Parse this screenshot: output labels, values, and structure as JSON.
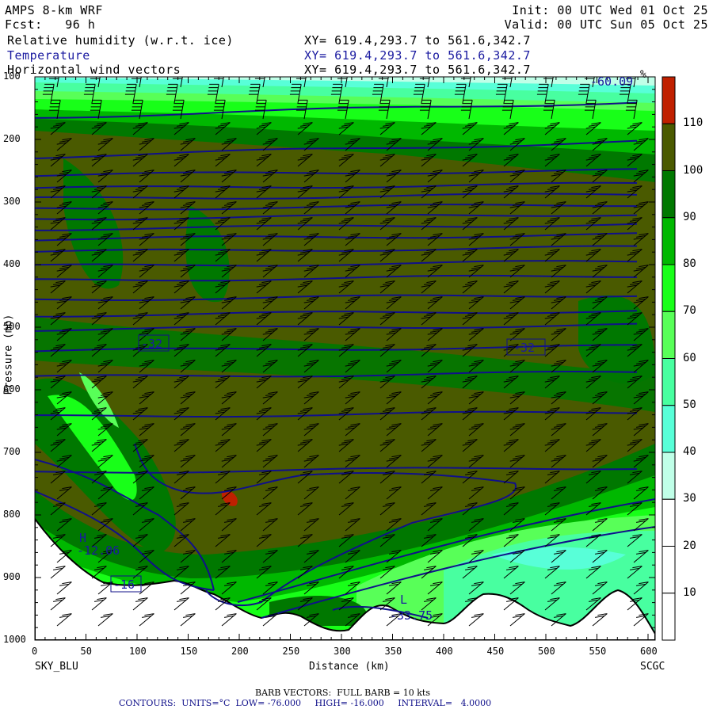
{
  "header": {
    "model": "AMPS 8-km WRF",
    "forecast": "Fcst:   96 h",
    "init": "Init: 00 UTC Wed 01 Oct 25",
    "valid": "Valid: 00 UTC Sun 05 Oct 25",
    "fields": [
      {
        "name": "Relative humidity (w.r.t. ice)",
        "xy": "XY= 619.4,293.7 to 561.6,342.7"
      },
      {
        "name": "Temperature",
        "xy": "XY= 619.4,293.7 to 561.6,342.7"
      },
      {
        "name": "Horizontal wind vectors",
        "xy": "XY= 619.4,293.7 to 561.6,342.7"
      }
    ]
  },
  "colors": {
    "contour": "#10108a",
    "label_blue": "#1a1aa0"
  },
  "chart_data": {
    "type": "heatmap",
    "title": "Cross-section: RH (w.r.t. ice), Temperature, Horizontal wind",
    "xlabel": "Distance (km)",
    "ylabel": "Pressure (mb)",
    "xlim": [
      0,
      610
    ],
    "ylim": [
      1000,
      100
    ],
    "x_ticks": [
      "0",
      "50",
      "100",
      "150",
      "200",
      "250",
      "300",
      "350",
      "400",
      "450",
      "500",
      "550",
      "600"
    ],
    "y_ticks": [
      "100",
      "200",
      "300",
      "400",
      "500",
      "600",
      "700",
      "800",
      "900",
      "1000"
    ],
    "x_endpoints": {
      "left": "SKY_BLU",
      "right": "SCGC"
    },
    "colorbar": {
      "unit": "%",
      "labels": [
        "110",
        "100",
        "90",
        "80",
        "70",
        "60",
        "50",
        "40",
        "30",
        "20",
        "10"
      ],
      "bins": [
        {
          "range": ">110",
          "color": "#c02000"
        },
        {
          "range": "100-110",
          "color": "#4a5a00"
        },
        {
          "range": "90-100",
          "color": "#007800"
        },
        {
          "range": "80-90",
          "color": "#00b800"
        },
        {
          "range": "70-80",
          "color": "#18ff18"
        },
        {
          "range": "60-70",
          "color": "#58ff58"
        },
        {
          "range": "50-60",
          "color": "#48ffa0"
        },
        {
          "range": "40-50",
          "color": "#58ffd8"
        },
        {
          "range": "30-40",
          "color": "#c0ffe8"
        },
        {
          "range": "20-30",
          "color": "#ffffff"
        },
        {
          "range": "10-20",
          "color": "#ffffff"
        },
        {
          "range": "<10",
          "color": "#ffffff"
        }
      ]
    },
    "contour_labels": [
      {
        "text": "-32",
        "distance_km": 115,
        "pressure": 520
      },
      {
        "text": "-32",
        "distance_km": 480,
        "pressure": 525
      },
      {
        "text": "-16",
        "distance_km": 88,
        "pressure": 910
      },
      {
        "text": "-60.09",
        "distance_km": 560,
        "pressure": 100
      },
      {
        "text": "-12.06",
        "distance_km": 62,
        "pressure": 865,
        "extremum": "H"
      },
      {
        "text": "-33.75",
        "distance_km": 365,
        "pressure": 960,
        "extremum": "L"
      }
    ],
    "contour_info": {
      "units": "°C",
      "low": -76.0,
      "high": -16.0,
      "interval": 4.0
    }
  },
  "footer": {
    "barb": "BARB VECTORS:  FULL BARB = 10 kts",
    "contours": "CONTOURS:  UNITS=°C  LOW= -76.000     HIGH= -16.000     INTERVAL=   4.0000"
  }
}
